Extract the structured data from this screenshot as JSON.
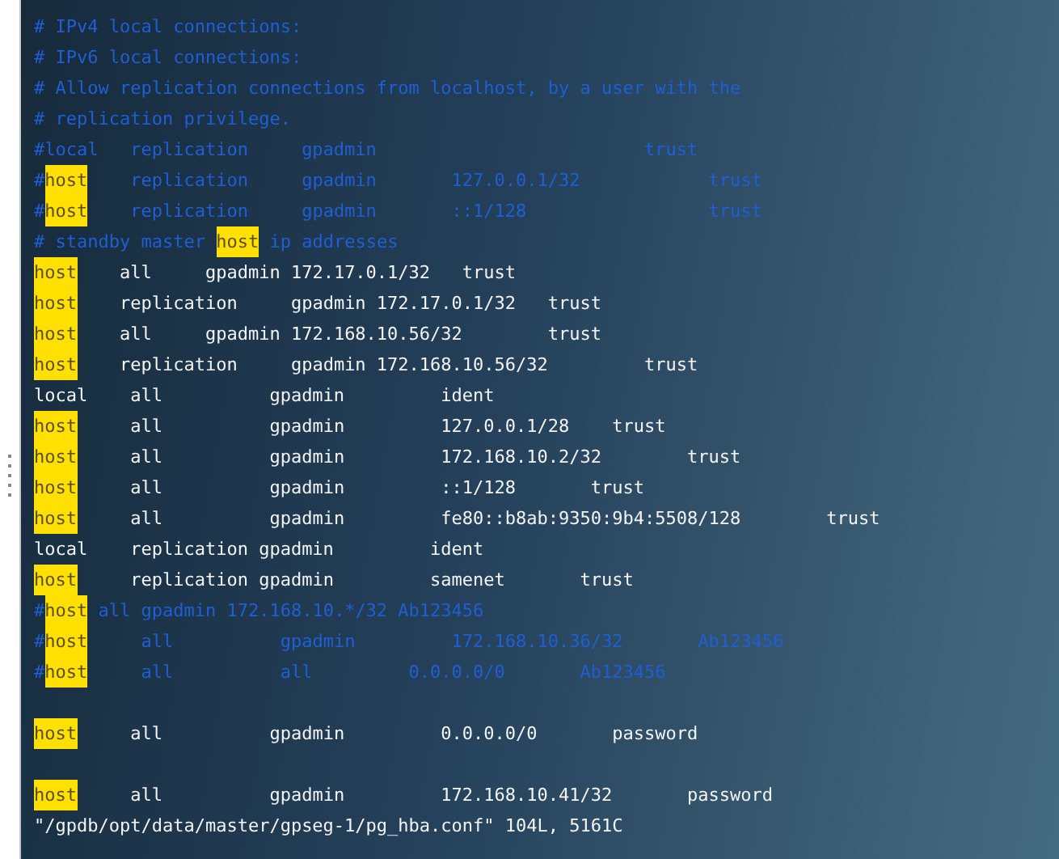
{
  "lines": [
    {
      "kind": "comment",
      "parts": [
        {
          "text": "# IPv4 local connections:",
          "highlight": false
        }
      ]
    },
    {
      "kind": "comment",
      "parts": [
        {
          "text": "# IPv6 local connections:",
          "highlight": false
        }
      ]
    },
    {
      "kind": "comment",
      "parts": [
        {
          "text": "# Allow replication connections from localhost, by a user with the",
          "highlight": false
        }
      ]
    },
    {
      "kind": "comment",
      "parts": [
        {
          "text": "# replication privilege.",
          "highlight": false
        }
      ]
    },
    {
      "kind": "comment",
      "parts": [
        {
          "text": "#local   replication     gpadmin                         trust",
          "highlight": false
        }
      ]
    },
    {
      "kind": "comment",
      "parts": [
        {
          "text": "#",
          "highlight": false
        },
        {
          "text": "host",
          "highlight": true
        },
        {
          "text": "    replication     gpadmin       127.0.0.1/32            trust",
          "highlight": false
        }
      ]
    },
    {
      "kind": "comment",
      "parts": [
        {
          "text": "#",
          "highlight": false
        },
        {
          "text": "host",
          "highlight": true
        },
        {
          "text": "    replication     gpadmin       ::1/128                 trust",
          "highlight": false
        }
      ]
    },
    {
      "kind": "comment",
      "parts": [
        {
          "text": "# standby master ",
          "highlight": false
        },
        {
          "text": "host",
          "highlight": true
        },
        {
          "text": " ip addresses",
          "highlight": false
        }
      ]
    },
    {
      "kind": "code",
      "parts": [
        {
          "text": "host",
          "highlight": true
        },
        {
          "text": "    all     gpadmin 172.17.0.1/32   trust",
          "highlight": false
        }
      ]
    },
    {
      "kind": "code",
      "parts": [
        {
          "text": "host",
          "highlight": true
        },
        {
          "text": "    replication     gpadmin 172.17.0.1/32   trust",
          "highlight": false
        }
      ]
    },
    {
      "kind": "code",
      "parts": [
        {
          "text": "host",
          "highlight": true
        },
        {
          "text": "    all     gpadmin 172.168.10.56/32        trust",
          "highlight": false
        }
      ]
    },
    {
      "kind": "code",
      "parts": [
        {
          "text": "host",
          "highlight": true
        },
        {
          "text": "    replication     gpadmin 172.168.10.56/32         trust",
          "highlight": false
        }
      ]
    },
    {
      "kind": "code",
      "parts": [
        {
          "text": "local    all          gpadmin         ident",
          "highlight": false
        }
      ]
    },
    {
      "kind": "code",
      "parts": [
        {
          "text": "host",
          "highlight": true
        },
        {
          "text": "     all          gpadmin         127.0.0.1/28    trust",
          "highlight": false
        }
      ]
    },
    {
      "kind": "code",
      "parts": [
        {
          "text": "host",
          "highlight": true
        },
        {
          "text": "     all          gpadmin         172.168.10.2/32        trust",
          "highlight": false
        }
      ]
    },
    {
      "kind": "code",
      "parts": [
        {
          "text": "host",
          "highlight": true
        },
        {
          "text": "     all          gpadmin         ::1/128       trust",
          "highlight": false
        }
      ]
    },
    {
      "kind": "code",
      "parts": [
        {
          "text": "host",
          "highlight": true
        },
        {
          "text": "     all          gpadmin         fe80::b8ab:9350:9b4:5508/128        trust",
          "highlight": false
        }
      ]
    },
    {
      "kind": "code",
      "parts": [
        {
          "text": "local    replication gpadmin         ident",
          "highlight": false
        }
      ]
    },
    {
      "kind": "code",
      "parts": [
        {
          "text": "host",
          "highlight": true
        },
        {
          "text": "     replication gpadmin         samenet       trust",
          "highlight": false
        }
      ]
    },
    {
      "kind": "comment",
      "parts": [
        {
          "text": "#",
          "highlight": false
        },
        {
          "text": "host",
          "highlight": true
        },
        {
          "text": " all gpadmin 172.168.10.*/32 Ab123456",
          "highlight": false
        }
      ]
    },
    {
      "kind": "comment",
      "parts": [
        {
          "text": "#",
          "highlight": false
        },
        {
          "text": "host",
          "highlight": true
        },
        {
          "text": "     all          gpadmin         172.168.10.36/32       Ab123456",
          "highlight": false
        }
      ]
    },
    {
      "kind": "comment",
      "parts": [
        {
          "text": "#",
          "highlight": false
        },
        {
          "text": "host",
          "highlight": true
        },
        {
          "text": "     all          all         0.0.0.0/0       Ab123456",
          "highlight": false
        }
      ]
    },
    {
      "kind": "blank"
    },
    {
      "kind": "code",
      "parts": [
        {
          "text": "host",
          "highlight": true
        },
        {
          "text": "     all          gpadmin         0.0.0.0/0       password",
          "highlight": false
        }
      ]
    },
    {
      "kind": "blank"
    },
    {
      "kind": "code",
      "parts": [
        {
          "text": "host",
          "highlight": true
        },
        {
          "text": "     all          gpadmin         172.168.10.41/32       password",
          "highlight": false
        }
      ]
    },
    {
      "kind": "status",
      "parts": [
        {
          "text": "\"/gpdb/opt/data/master/gpseg-1/pg_hba.conf\" 104L, 5161C",
          "highlight": false
        }
      ]
    }
  ]
}
